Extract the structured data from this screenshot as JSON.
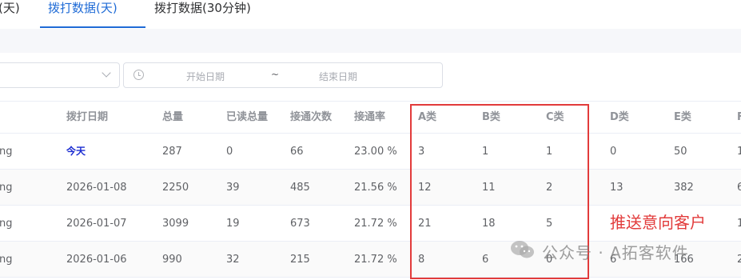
{
  "tabs": [
    {
      "label": "(天)",
      "partial": true
    },
    {
      "label": "拨打数据(天)",
      "active": true
    },
    {
      "label": "拨打数据(30分钟)"
    }
  ],
  "filters": {
    "date_start_placeholder": "开始日期",
    "date_separator": "~",
    "date_end_placeholder": "结束日期"
  },
  "table": {
    "headers": [
      "",
      "拨打日期",
      "总量",
      "已读总量",
      "接通次数",
      "接通率",
      "A类",
      "B类",
      "C类",
      "D类",
      "E类",
      "F"
    ],
    "rows": [
      [
        "ng",
        "今天",
        "287",
        "0",
        "66",
        "23.00 %",
        "3",
        "1",
        "1",
        "0",
        "50",
        "1"
      ],
      [
        "ng",
        "2026-01-08",
        "2250",
        "39",
        "485",
        "21.56 %",
        "12",
        "11",
        "2",
        "13",
        "382",
        "6"
      ],
      [
        "ng",
        "2026-01-07",
        "3099",
        "19",
        "673",
        "21.72 %",
        "21",
        "18",
        "5",
        "",
        "",
        "1"
      ],
      [
        "ng",
        "2026-01-06",
        "990",
        "32",
        "215",
        "21.72 %",
        "8",
        "6",
        "0",
        "6",
        "166",
        "2"
      ]
    ]
  },
  "annotation": "推送意向客户",
  "watermark": "公众号 · A拓客软件",
  "colors": {
    "accent": "#1f6bd6",
    "highlight": "#e23b3b",
    "today": "#1a2bd1"
  }
}
